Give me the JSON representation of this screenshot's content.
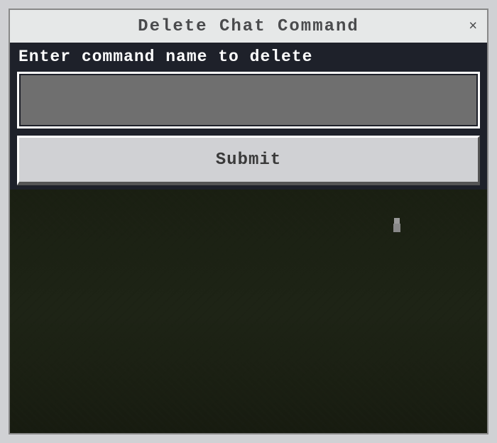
{
  "window": {
    "title": "Delete Chat Command",
    "close_label": "×"
  },
  "form": {
    "label": "Enter command name to delete",
    "input_value": "",
    "submit_label": "Submit"
  }
}
